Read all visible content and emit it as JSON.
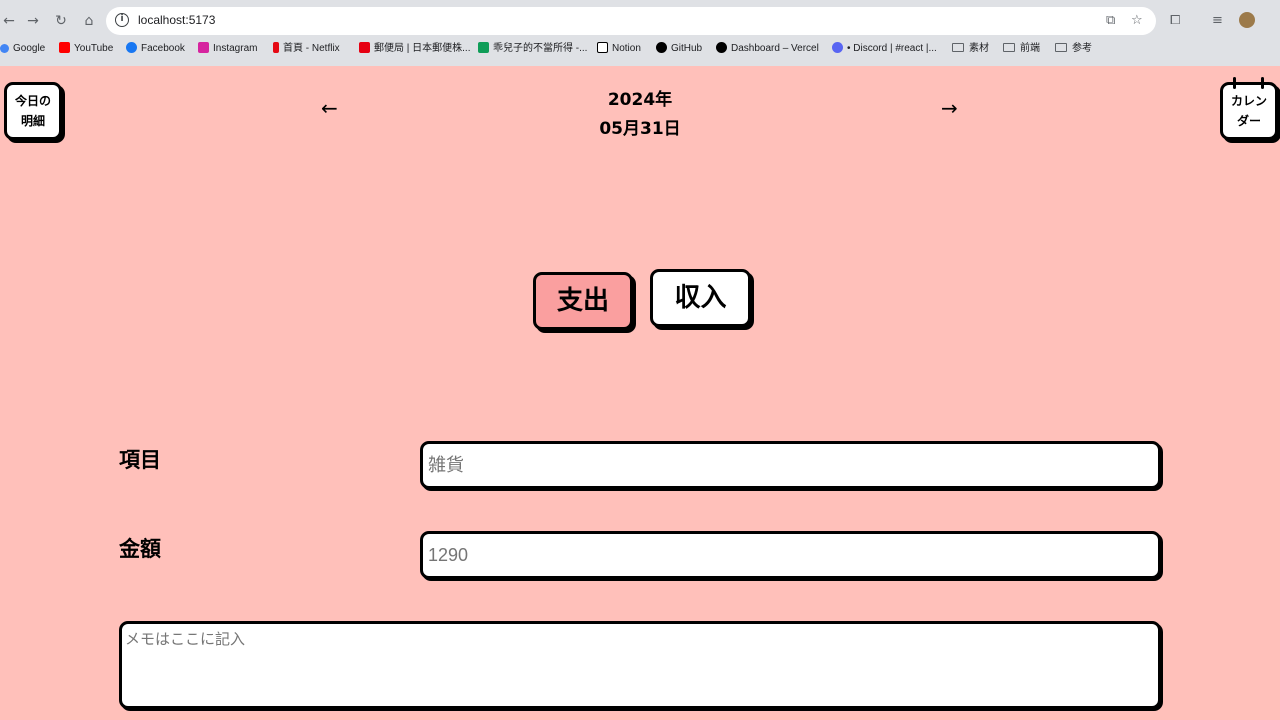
{
  "browser": {
    "url": "localhost:5173",
    "bookmarks": [
      {
        "label": "Google",
        "color": "#4285f4"
      },
      {
        "label": "YouTube",
        "color": "#ff0000"
      },
      {
        "label": "Facebook",
        "color": "#1877f2"
      },
      {
        "label": "Instagram",
        "color": "#d6249f"
      },
      {
        "label": "首頁 - Netflix",
        "color": "#e50914"
      },
      {
        "label": "郵便局 | 日本郵便株...",
        "color": "#e60012"
      },
      {
        "label": "乖兒子的不當所得 -...",
        "color": "#0f9d58"
      },
      {
        "label": "Notion",
        "color": "#000000"
      },
      {
        "label": "GitHub",
        "color": "#000000"
      },
      {
        "label": "Dashboard – Vercel",
        "color": "#000000"
      },
      {
        "label": "• Discord | #react |...",
        "color": "#5865f2"
      },
      {
        "label": "素材",
        "color": ""
      },
      {
        "label": "前端",
        "color": ""
      },
      {
        "label": "参考",
        "color": ""
      }
    ]
  },
  "app": {
    "today_btn": {
      "line1": "今日の",
      "line2": "明細"
    },
    "calendar_btn": {
      "line1": "カレン",
      "line2": "ダー"
    },
    "prev_arrow": "←",
    "next_arrow": "→",
    "year": "2024年",
    "date": "05月31日",
    "expense_label": "支出",
    "income_label": "収入",
    "item_label": "項目",
    "item_placeholder": "雑貨",
    "amount_label": "金額",
    "amount_placeholder": "1290",
    "memo_placeholder": "メモはここに記入",
    "colors": {
      "background": "#ffc0ba",
      "expense_active": "#fa9f9f",
      "border": "#000000"
    }
  }
}
